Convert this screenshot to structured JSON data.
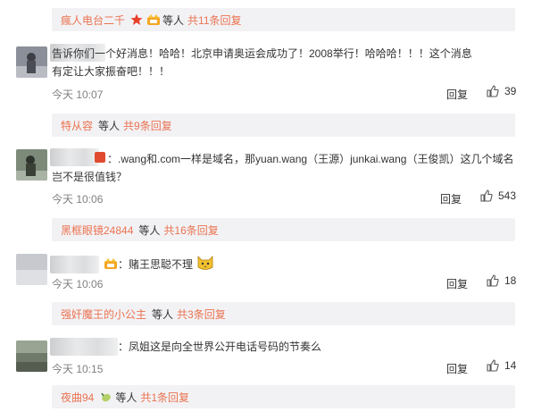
{
  "colors": {
    "accent": "#eb7350",
    "bar_bg": "#f2f2f5",
    "meta": "#808080"
  },
  "top_reply_bar": {
    "name": "瘋人电台二千",
    "suffix": "等人",
    "count_text": "共11条回复"
  },
  "comments": [
    {
      "text_line1": "告诉你们一个好消息！哈哈！北京申请奥运会成功了！2008举行！哈哈哈！！！这个消息",
      "text_line2": "有定让大家振奋吧！！！",
      "time": "今天 10:07",
      "reply_label": "回复",
      "likes": "39",
      "reply_bar": {
        "name": "特从容",
        "suffix": "等人",
        "count_text": "共9条回复"
      }
    },
    {
      "text_line1": "：.wang和.com一样是域名，那yuan.wang（王源）junkai.wang（王俊凯）这几个域名",
      "text_line2": "岂不是很值钱？",
      "time": "今天 10:06",
      "reply_label": "回复",
      "likes": "543",
      "reply_bar": {
        "name": "黑框眼镜24844",
        "suffix": "等人",
        "count_text": "共16条回复"
      }
    },
    {
      "text_line1": "：赌王思聪不理",
      "time": "今天 10:06",
      "reply_label": "回复",
      "likes": "18",
      "reply_bar": {
        "name": "强奸魔王的小公主",
        "suffix": "等人",
        "count_text": "共3条回复"
      }
    },
    {
      "text_line1": "：凤姐这是向全世界公开电话号码的节奏么",
      "time": "今天 10:15",
      "reply_label": "回复",
      "likes": "14",
      "reply_bar": {
        "name": "夜曲94",
        "suffix": "等人",
        "count_text": "共1条回复"
      }
    }
  ]
}
